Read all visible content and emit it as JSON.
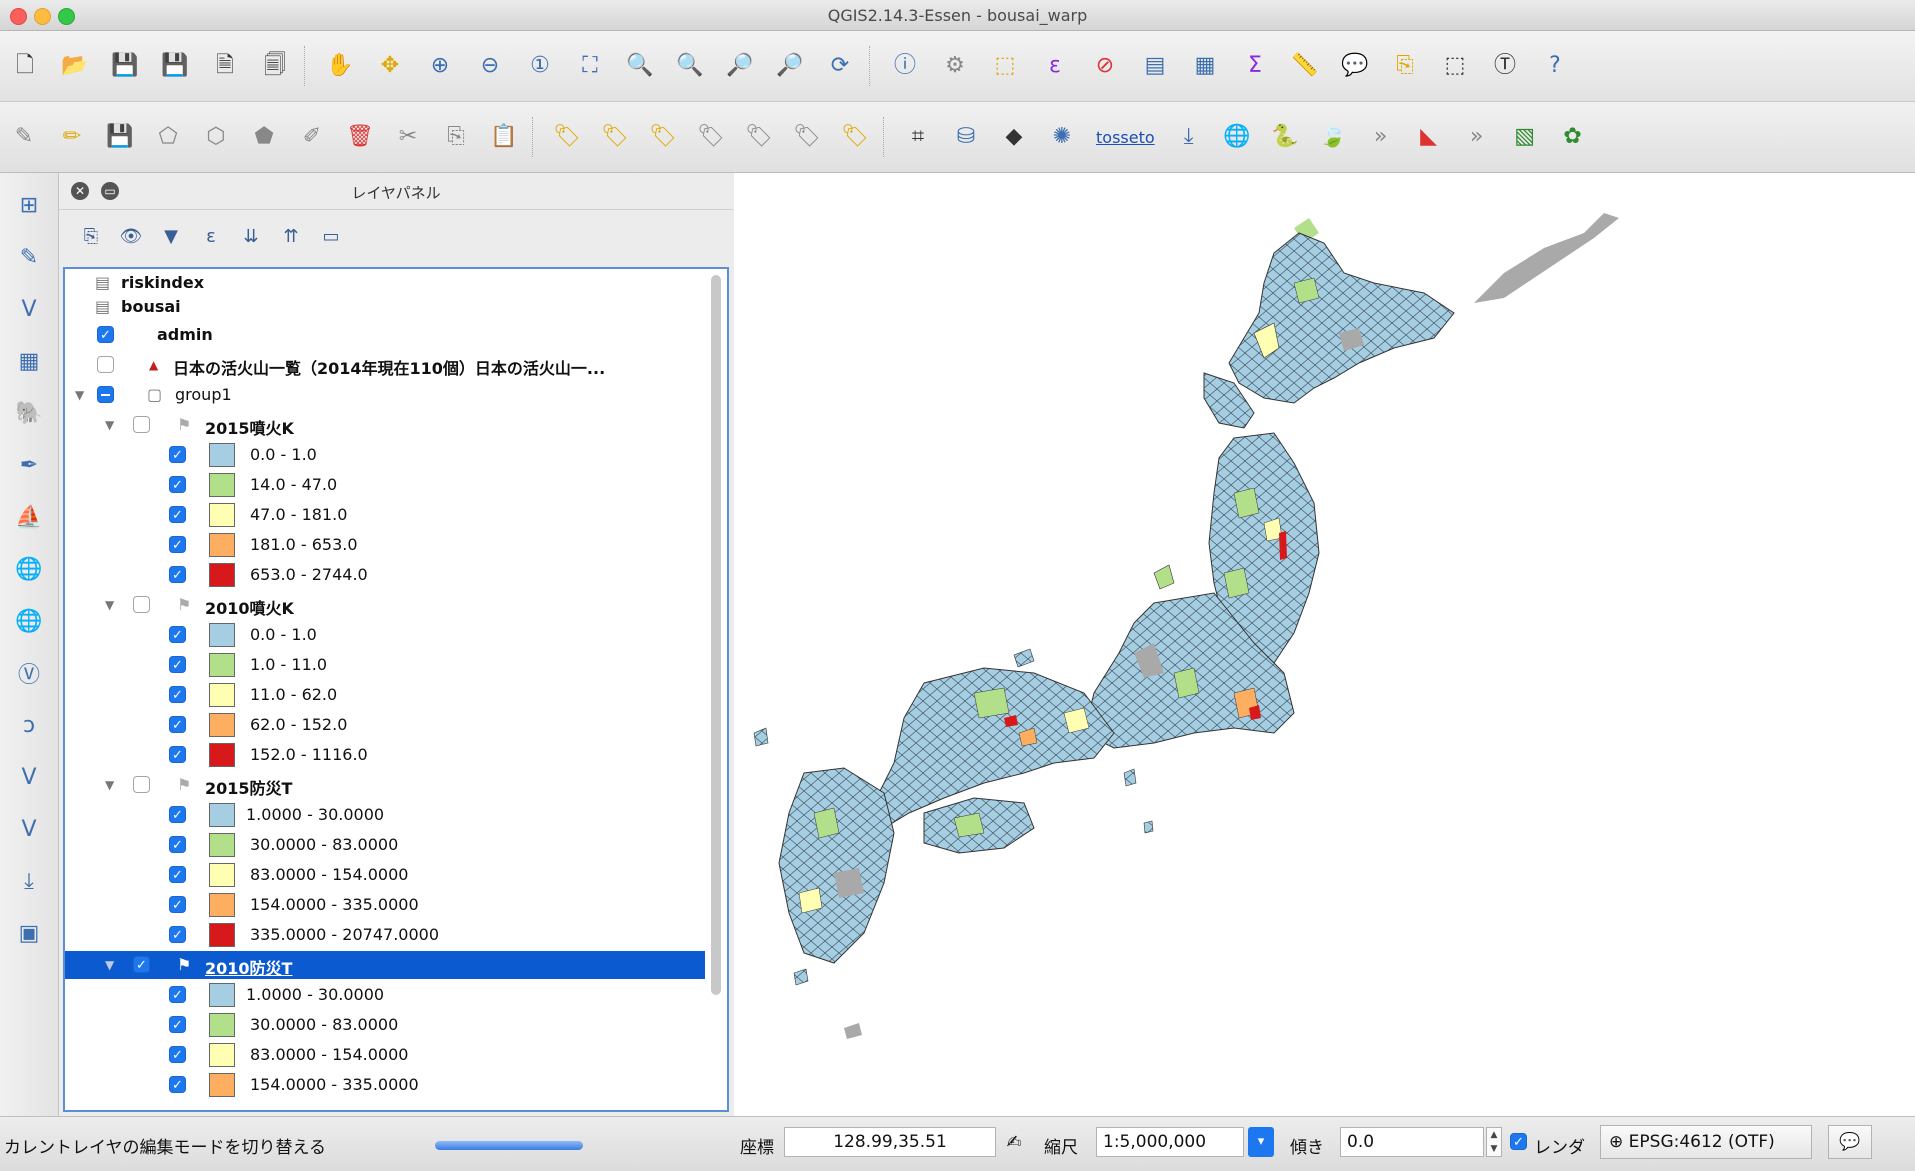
{
  "window": {
    "title": "QGIS2.14.3-Essen - bousai_warp"
  },
  "toolbar2": {
    "plugin_label": "tosseto"
  },
  "layer_panel": {
    "title": "レイヤパネル",
    "layers": [
      {
        "label": "riskindex"
      },
      {
        "label": "bousai"
      },
      {
        "label": "admin"
      },
      {
        "label": "日本の活火山一覧（2014年現在110個）日本の活火山一..."
      },
      {
        "label": "group1"
      },
      {
        "label": "2015噴火K",
        "classes": [
          "0.0 - 1.0",
          "14.0 - 47.0",
          "47.0 - 181.0",
          "181.0 - 653.0",
          "653.0 - 2744.0"
        ]
      },
      {
        "label": "2010噴火K",
        "classes": [
          "0.0 - 1.0",
          "1.0 - 11.0",
          "11.0 - 62.0",
          "62.0 - 152.0",
          "152.0 - 1116.0"
        ]
      },
      {
        "label": "2015防災T",
        "classes": [
          "1.0000 - 30.0000",
          "30.0000 - 83.0000",
          "83.0000 - 154.0000",
          "154.0000 - 335.0000",
          "335.0000 - 20747.0000"
        ]
      },
      {
        "label": "2010防災T",
        "classes": [
          "1.0000 - 30.0000",
          "30.0000 - 83.0000",
          "83.0000 - 154.0000",
          "154.0000 - 335.0000"
        ]
      }
    ],
    "class_colors": [
      "#a6cee3",
      "#b2df8a",
      "#ffffb3",
      "#fdae61",
      "#d7191c"
    ]
  },
  "statusbar": {
    "message": "カレントレイヤの編集モードを切り替える",
    "coord_label": "座標",
    "coord_value": "128.99,35.51",
    "scale_label": "縮尺",
    "scale_value": "1:5,000,000",
    "rotation_label": "傾き",
    "rotation_value": "0.0",
    "render_label": "レンダ",
    "crs_label": "EPSG:4612 (OTF)"
  }
}
